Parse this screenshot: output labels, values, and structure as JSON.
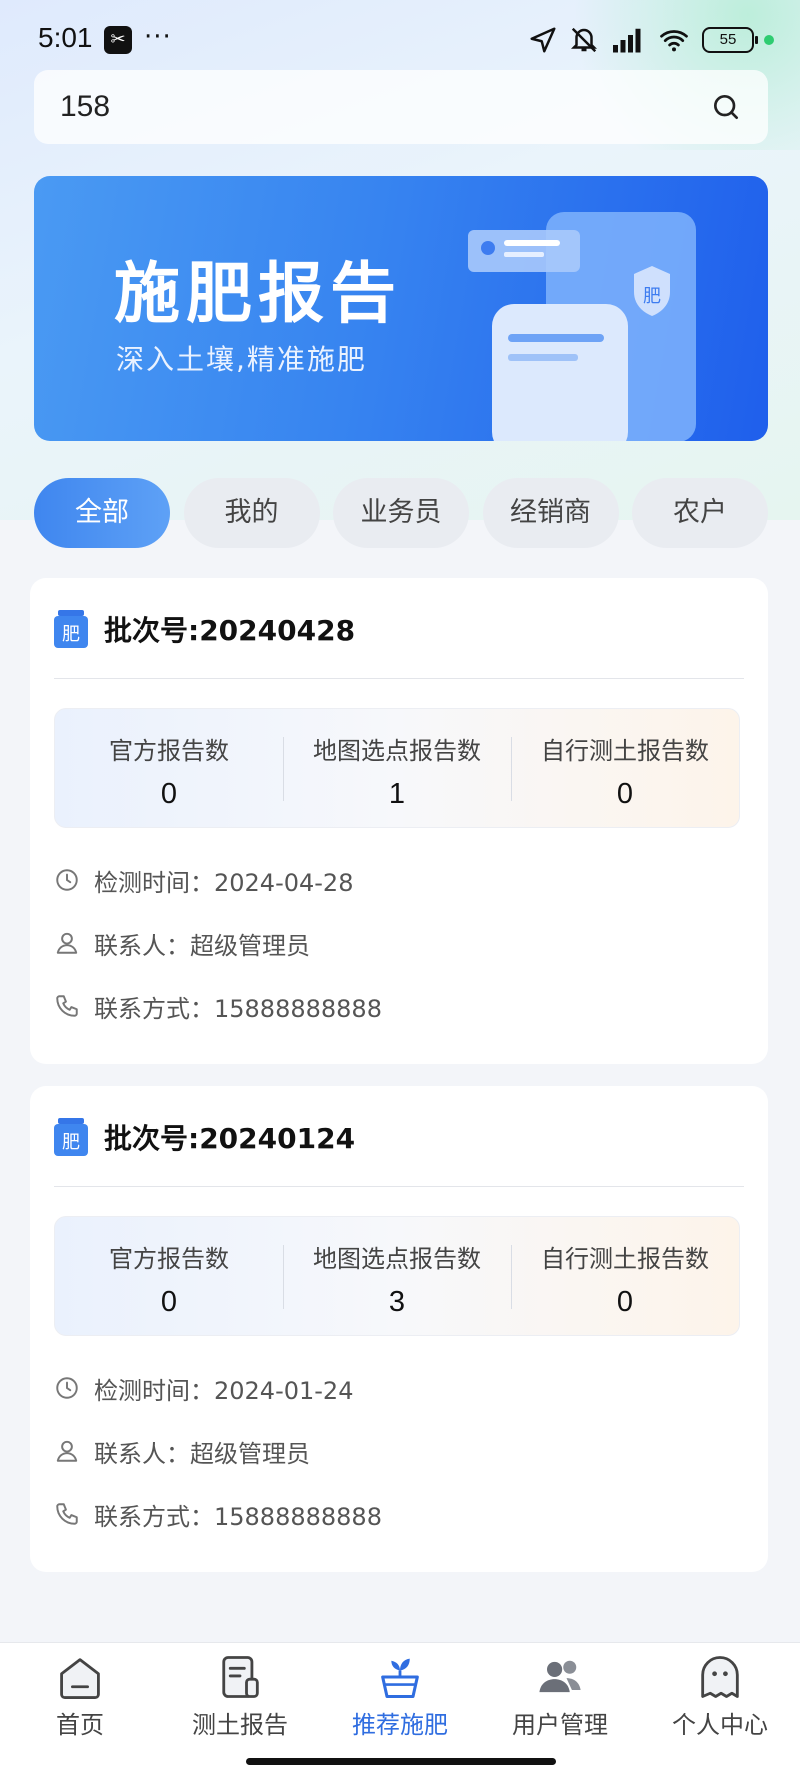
{
  "status_bar": {
    "time": "5:01",
    "dots": "···",
    "battery": "55"
  },
  "search": {
    "value": "158"
  },
  "banner": {
    "title": "施肥报告",
    "subtitle": "深入土壤,精准施肥",
    "doc_badge": "肥"
  },
  "tabs": [
    {
      "label": "全部",
      "active": true
    },
    {
      "label": "我的",
      "active": false
    },
    {
      "label": "业务员",
      "active": false
    },
    {
      "label": "经销商",
      "active": false
    },
    {
      "label": "农户",
      "active": false
    }
  ],
  "cards": [
    {
      "batch": "批次号:20240428",
      "badge_text": "肥",
      "stats": [
        {
          "label": "官方报告数",
          "value": "0"
        },
        {
          "label": "地图选点报告数",
          "value": "1"
        },
        {
          "label": "自行测土报告数",
          "value": "0"
        }
      ],
      "detect_time": "检测时间：2024-04-28",
      "contact": "联系人：超级管理员",
      "phone": "联系方式：15888888888"
    },
    {
      "batch": "批次号:20240124",
      "badge_text": "肥",
      "stats": [
        {
          "label": "官方报告数",
          "value": "0"
        },
        {
          "label": "地图选点报告数",
          "value": "3"
        },
        {
          "label": "自行测土报告数",
          "value": "0"
        }
      ],
      "detect_time": "检测时间：2024-01-24",
      "contact": "联系人：超级管理员",
      "phone": "联系方式：15888888888"
    }
  ],
  "nav": [
    {
      "label": "首页",
      "icon": "home-icon"
    },
    {
      "label": "测土报告",
      "icon": "report-icon"
    },
    {
      "label": "推荐施肥",
      "icon": "plant-pot-icon",
      "active": true
    },
    {
      "label": "用户管理",
      "icon": "users-icon"
    },
    {
      "label": "个人中心",
      "icon": "profile-icon"
    }
  ],
  "colors": {
    "accent": "#2f6de0",
    "tab_active": "#3f86ef",
    "banner": "#3784f0"
  }
}
